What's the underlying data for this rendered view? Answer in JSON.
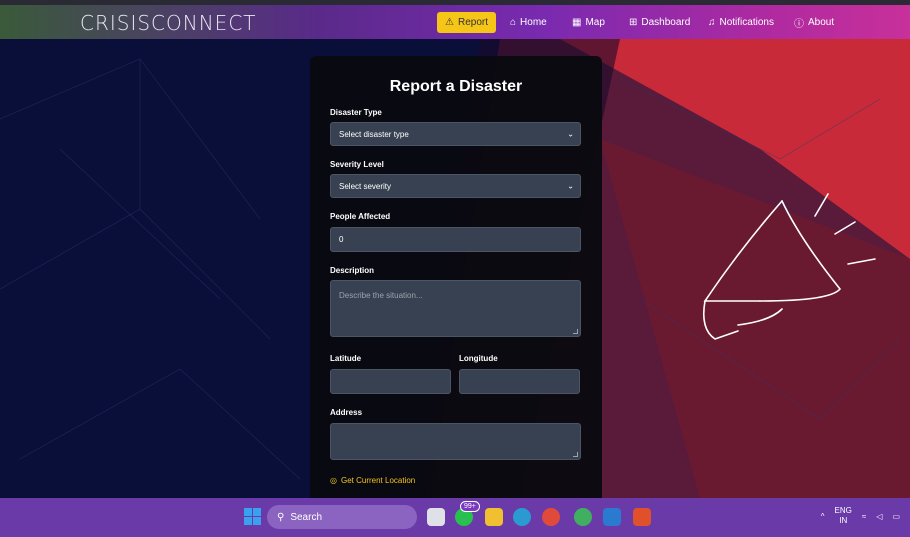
{
  "navbar": {
    "brand": "CRISISCONNECT",
    "items": [
      {
        "label": "Report",
        "icon": "warning-icon",
        "active": true
      },
      {
        "label": "Home",
        "icon": "home-icon"
      },
      {
        "label": "Map",
        "icon": "map-icon"
      },
      {
        "label": "Dashboard",
        "icon": "dashboard-icon"
      },
      {
        "label": "Notifications",
        "icon": "bell-icon"
      },
      {
        "label": "About",
        "icon": "info-icon"
      }
    ]
  },
  "form": {
    "title": "Report a Disaster",
    "disaster_type_label": "Disaster Type",
    "disaster_type_value": "Select disaster type",
    "severity_label": "Severity Level",
    "severity_value": "Select severity",
    "people_label": "People Affected",
    "people_value": "0",
    "description_label": "Description",
    "description_placeholder": "Describe the situation...",
    "latitude_label": "Latitude",
    "longitude_label": "Longitude",
    "address_label": "Address",
    "location_link": "Get Current Location"
  },
  "taskbar": {
    "search_label": "Search",
    "badge": "99+",
    "lang_top": "ENG",
    "lang_bottom": "IN"
  },
  "colors": {
    "accent": "#f5c518",
    "card": "#0a0a0f",
    "field": "#374151"
  }
}
